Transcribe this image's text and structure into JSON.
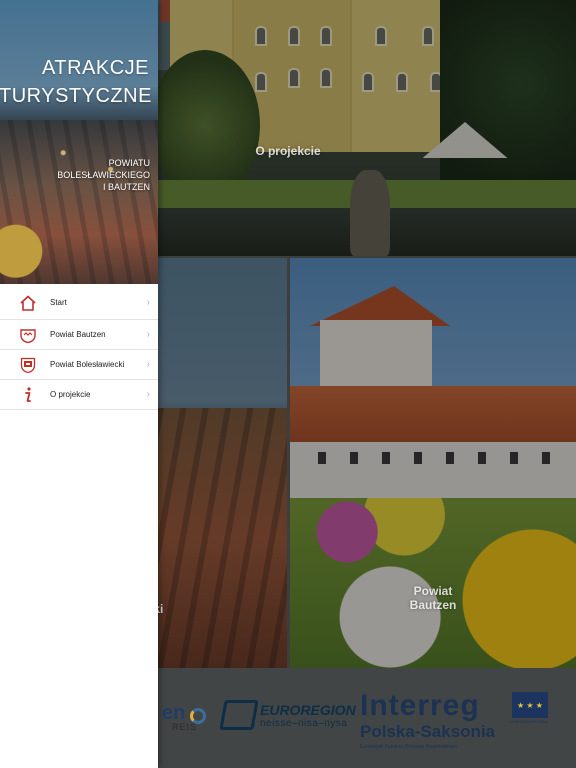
{
  "drawer": {
    "header": {
      "title": "ATRAKCJE TURYSTYCZNE",
      "subtitle_lines": [
        "POWIATU",
        "BOLESŁAWIECKIEGO",
        "I BAUTZEN"
      ]
    },
    "menu": [
      {
        "label": "Start",
        "icon": "home-icon"
      },
      {
        "label": "Powiat Bautzen",
        "icon": "crown-crest-icon"
      },
      {
        "label": "Powiat Bolesławiecki",
        "icon": "shield-crest-icon"
      },
      {
        "label": "O projekcie",
        "icon": "info-icon"
      }
    ],
    "accent_color": "#c0302a"
  },
  "tiles": {
    "about": {
      "label": "O projekcie"
    },
    "city": {
      "label_fragment": "ecki"
    },
    "bautzen": {
      "label_lines": [
        "Powiat",
        "Bautzen"
      ]
    }
  },
  "logos": {
    "fragment": {
      "text": "en",
      "sub": "REIS"
    },
    "euroregion": {
      "line1": "EUROREGION",
      "line2": "neisse–nisa–nysa"
    },
    "interreg": {
      "line1": "Interreg",
      "line2": "Polska-Saksonia",
      "line3": "Europejski Fundusz Rozwoju Regionalnego"
    },
    "eu_label": "UNIA EUROPEJSKA"
  }
}
